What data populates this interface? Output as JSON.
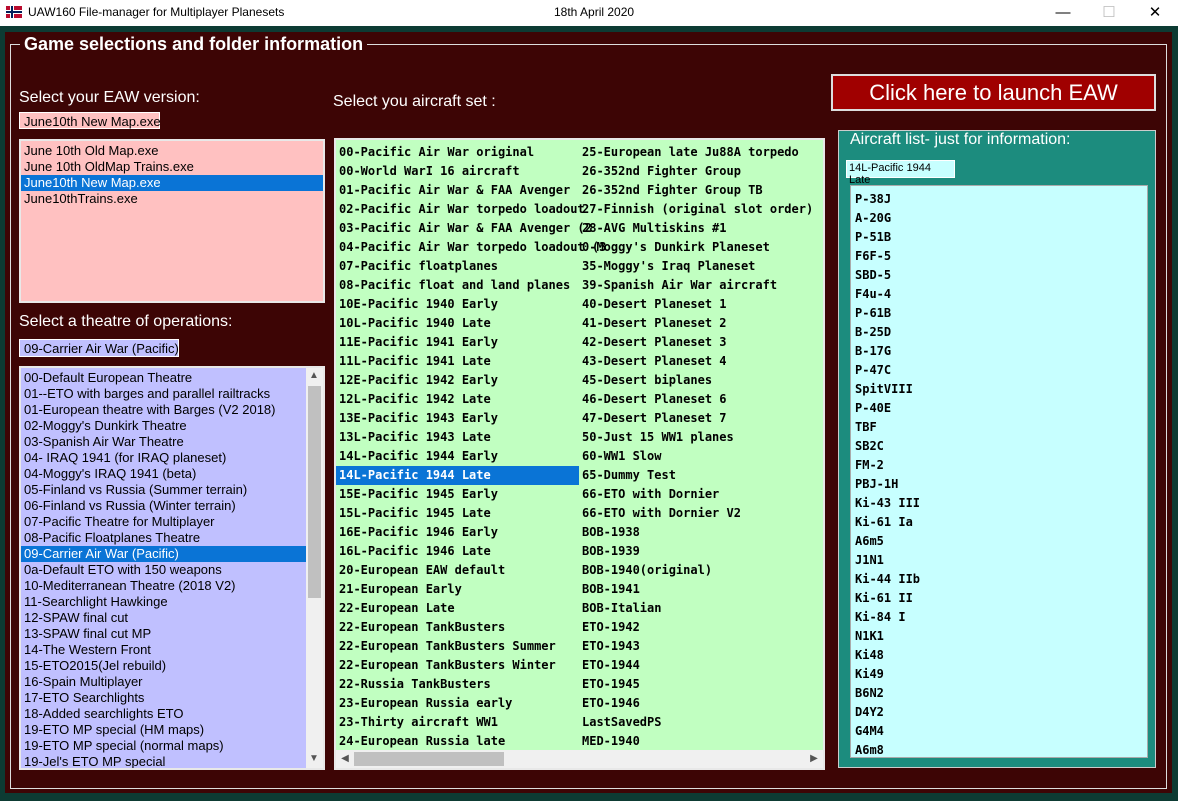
{
  "window": {
    "title": "UAW160 File-manager for Multiplayer Planesets",
    "date": "18th April 2020",
    "minimize": "—",
    "maximize": "☐",
    "close": "✕"
  },
  "frame_title": "Game selections and folder information",
  "eaw": {
    "label": "Select your EAW version:",
    "current": "June10th New Map.exe",
    "items": [
      "June 10th Old Map.exe",
      "June 10th OldMap Trains.exe",
      "June10th New Map.exe",
      "June10thTrains.exe"
    ],
    "selected_index": 2
  },
  "theatre": {
    "label": "Select a theatre of operations:",
    "current": "09-Carrier Air War (Pacific)",
    "items": [
      "00-Default European Theatre",
      "01--ETO with barges and parallel railtracks",
      "01-European theatre with Barges (V2 2018)",
      "02-Moggy's Dunkirk Theatre",
      "03-Spanish Air War Theatre",
      "04- IRAQ 1941 (for IRAQ planeset)",
      "04-Moggy's IRAQ 1941 (beta)",
      "05-Finland vs Russia (Summer terrain)",
      "06-Finland vs Russia (Winter terrain)",
      "07-Pacific Theatre for Multiplayer",
      "08-Pacific Floatplanes Theatre",
      "09-Carrier Air War (Pacific)",
      "0a-Default ETO with 150 weapons",
      "10-Mediterranean Theatre (2018 V2)",
      "11-Searchlight Hawkinge",
      "12-SPAW final cut",
      "13-SPAW final cut MP",
      "14-The Western Front",
      "15-ETO2015(Jel rebuild)",
      "16-Spain Multiplayer",
      "17-ETO Searchlights",
      "18-Added searchlights ETO",
      "19-ETO MP special (HM maps)",
      "19-ETO MP special (normal maps)",
      "19-Jel's ETO MP special"
    ],
    "selected_index": 11,
    "scroll_up": "▲",
    "scroll_down": "▼"
  },
  "aircraft_set": {
    "label": "Select you aircraft set :",
    "col1": [
      "00-Pacific Air War original",
      "00-World WarI 16 aircraft",
      "01-Pacific Air War & FAA Avenger",
      "02-Pacific Air War torpedo loadout",
      "03-Pacific Air War & FAA Avenger (2",
      "04-Pacific Air War torpedo loadout (3",
      "07-Pacific floatplanes",
      "08-Pacific float and land planes",
      "10E-Pacific 1940 Early",
      "10L-Pacific 1940 Late",
      "11E-Pacific 1941 Early",
      "11L-Pacific 1941 Late",
      "12E-Pacific 1942 Early",
      "12L-Pacific 1942 Late",
      "13E-Pacific 1943 Early",
      "13L-Pacific 1943 Late",
      "14L-Pacific 1944 Early",
      "14L-Pacific 1944 Late",
      "15E-Pacific 1945 Early",
      "15L-Pacific 1945 Late",
      "16E-Pacific 1946 Early",
      "16L-Pacific 1946 Late",
      "20-European EAW default",
      "21-European Early",
      "22-European Late",
      "22-European TankBusters",
      "22-European TankBusters Summer",
      "22-European TankBusters Winter",
      "22-Russia TankBusters",
      "23-European Russia early",
      "23-Thirty aircraft WW1",
      "24-European Russia late"
    ],
    "col2": [
      "25-European late Ju88A torpedo",
      "26-352nd Fighter Group",
      "26-352nd Fighter Group TB",
      "27-Finnish (original slot  order)",
      "28-AVG Multiskins #1",
      "0-Moggy's Dunkirk Planeset",
      "35-Moggy's Iraq Planeset",
      "39-Spanish Air War aircraft",
      "40-Desert Planeset 1",
      "41-Desert Planeset 2",
      "42-Desert Planeset 3",
      "43-Desert Planeset 4",
      "45-Desert biplanes",
      "46-Desert Planeset 6",
      "47-Desert Planeset 7",
      "50-Just 15 WW1 planes",
      "60-WW1 Slow",
      "65-Dummy Test",
      "66-ETO with Dornier",
      "66-ETO with Dornier V2",
      "BOB-1938",
      "BOB-1939",
      "BOB-1940(original)",
      "BOB-1941",
      "BOB-Italian",
      "ETO-1942",
      "ETO-1943",
      "ETO-1944",
      "ETO-1945",
      "ETO-1946",
      "LastSavedPS",
      "MED-1940"
    ],
    "selected_col1_index": 17,
    "scroll_left": "◀",
    "scroll_right": "▶"
  },
  "launch_label": "Click here to launch EAW",
  "aircraft_list": {
    "label": "Aircraft list-  just for information:",
    "current": "14L-Pacific 1944 Late",
    "items": [
      "P-38J",
      "A-20G",
      "P-51B",
      "F6F-5",
      "SBD-5",
      "F4u-4",
      "P-61B",
      "B-25D",
      "B-17G",
      "P-47C",
      "SpitVIII",
      "P-40E",
      "TBF",
      "SB2C",
      "FM-2",
      "PBJ-1H",
      "Ki-43 III",
      "Ki-61 Ia",
      "A6m5",
      "J1N1",
      "Ki-44 IIb",
      "Ki-61 II",
      "Ki-84 I",
      "N1K1",
      "Ki48",
      "Ki49",
      "B6N2",
      "D4Y2",
      "G4M4",
      "A6m8"
    ]
  },
  "colors": {
    "panel": "#3d0505",
    "eaw_list": "#ffc1c1",
    "theatre_list": "#c0c0ff",
    "set_list": "#c1ffc1",
    "aircraft_list": "#c7ffff",
    "selection": "#0a74d6",
    "launch": "#a00000"
  }
}
